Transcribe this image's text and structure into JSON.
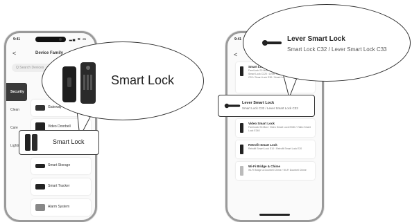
{
  "left_phone": {
    "time": "9:41",
    "status_icons": "▂▄ ≋ ▭",
    "back": "<",
    "title": "Device Family",
    "search_placeholder": "Q  Search Devices",
    "categories": [
      "Security",
      "Clean",
      "Care",
      "Lighting"
    ],
    "tiles": [
      "Gateway",
      "Video Doorbell",
      "Smart Lock",
      "Smart Storage",
      "Smart Tracker",
      "Alarm System"
    ],
    "callout_label": "Smart Lock"
  },
  "left_bubble": {
    "title": "Smart Lock"
  },
  "right_phone": {
    "time": "9:41",
    "back": "<",
    "cards": [
      {
        "title": "Smart Lock",
        "subtitle": "FamiLock S3 Max / Video Smart Lock / Smart Lock C210 / Smart Lock C220 / Lever Smart Lock C32 / Smart Lock C33 / Smart Lock E30 / Smart Lock S2"
      },
      {
        "title": "Lever Smart Lock",
        "subtitle": "Smart Lock C32 / Lever Smart Lock C33"
      },
      {
        "title": "Video Smart Lock",
        "subtitle": "FamiLock S3 Max / Video Smart Lock E330 / Video Smart Lock E340"
      },
      {
        "title": "Retrofit Smart Lock",
        "subtitle": "Retrofit Smart Lock E10 / Retrofit Smart Lock E20"
      },
      {
        "title": "Wi-Fi Bridge & Chime",
        "subtitle": "Wi-Fi Bridge & Doorbell Chime / Wi-Fi Doorbell Chime"
      }
    ]
  },
  "right_bubble": {
    "title": "Lever Smart Lock",
    "subtitle": "Smart Lock C32 / Lever Smart Lock C33"
  }
}
